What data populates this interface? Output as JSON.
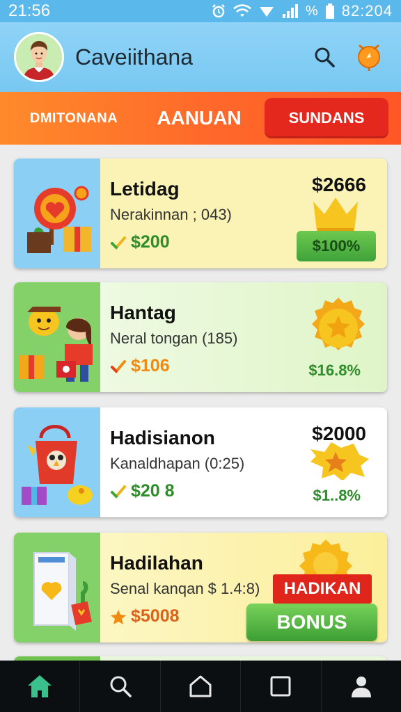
{
  "status_bar": {
    "time": "21:56",
    "percent_icon": "%",
    "battery_level": "82:204",
    "icons": [
      "alarm-icon",
      "wifi-icon",
      "signal-icon",
      "battery-icon"
    ]
  },
  "header": {
    "title": "Caveiithana",
    "avatar": "avatar-man-in-tuxedo",
    "icons": [
      "search-icon",
      "bell-icon"
    ]
  },
  "tabs": [
    {
      "label": "DMITONANA",
      "active": false
    },
    {
      "label": "AANUAN",
      "active": false
    },
    {
      "label": "SUNDANS",
      "active": true
    }
  ],
  "cards": [
    {
      "title": "Letidag",
      "subtitle": "Nerakinnan ; 043)",
      "reward": "$200",
      "reward_icon": "check-icon",
      "price": "$2666",
      "percent": "$100%",
      "deco": "gold-crown"
    },
    {
      "title": "Hantag",
      "subtitle": "Neral tongan (185)",
      "reward": "$106",
      "reward_icon": "check-icon",
      "percent": "$16.8%",
      "deco": "gold-coin"
    },
    {
      "title": "Hadisianon",
      "subtitle": "Kanaldhapan (0:25)",
      "reward": "$20 8",
      "reward_icon": "check-icon",
      "price": "$2000",
      "percent": "$1..8%",
      "deco": "gold-star-splash"
    },
    {
      "title": "Hadilahan",
      "subtitle": "Senal kanqan $ 1.4:8)",
      "reward": "$5008",
      "reward_icon": "star-icon",
      "badge": "HADIKAN",
      "button": "BONUS",
      "deco": "gold-gear"
    }
  ],
  "bottom_nav": [
    {
      "name": "home",
      "icon": "home-icon",
      "active": true
    },
    {
      "name": "search",
      "icon": "search-icon",
      "active": false
    },
    {
      "name": "home-outline",
      "icon": "house-outline-icon",
      "active": false
    },
    {
      "name": "recents",
      "icon": "square-icon",
      "active": false
    },
    {
      "name": "profile",
      "icon": "person-icon",
      "active": false
    }
  ],
  "colors": {
    "header": "#78c8f2",
    "tabs": "#ff6a2a",
    "active_tab": "#e5281e",
    "accent_green": "#3fa33a",
    "reward_green": "#2e8c2a",
    "reward_orange": "#f08a10",
    "nav_active": "#3cc08b"
  }
}
